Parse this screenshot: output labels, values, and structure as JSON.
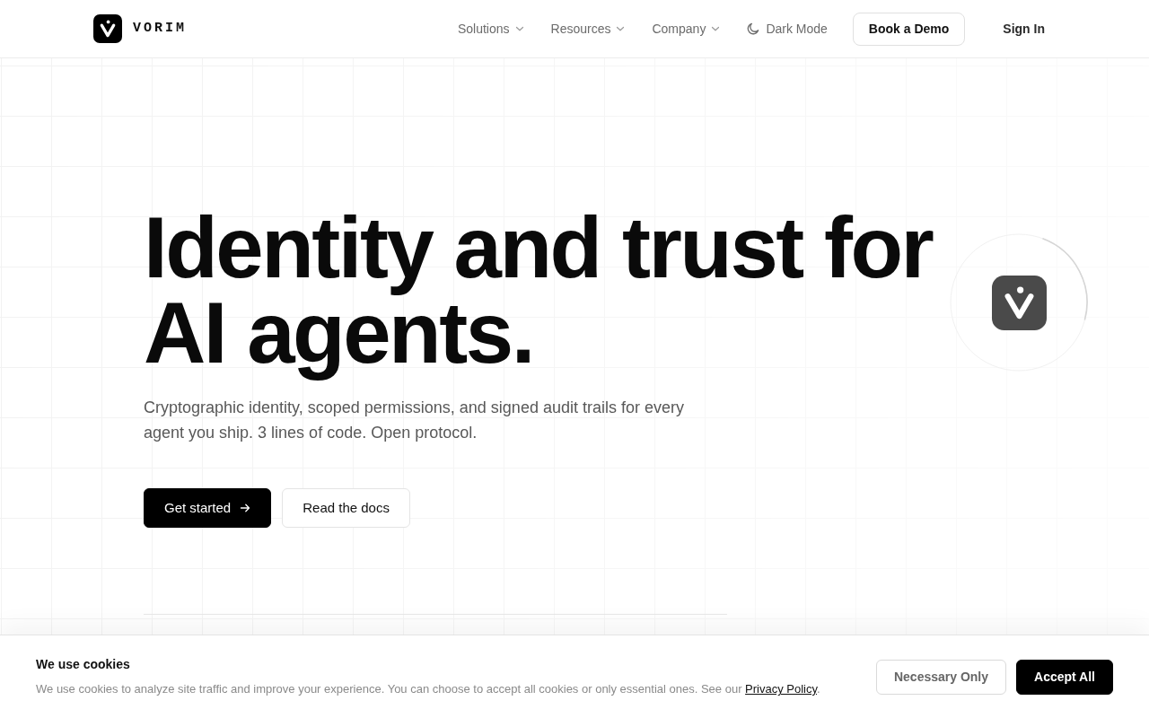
{
  "navbar": {
    "brand": "VORIM",
    "menu": [
      {
        "label": "Solutions",
        "kind": "dropdown"
      },
      {
        "label": "Resources",
        "kind": "dropdown"
      },
      {
        "label": "Company",
        "kind": "dropdown"
      },
      {
        "label": "Dark Mode",
        "kind": "theme-toggle"
      }
    ],
    "buttons": [
      {
        "label": "Book a Demo",
        "kind": "outline"
      },
      {
        "label": "Sign In",
        "kind": "plain"
      }
    ]
  },
  "hero": {
    "headline": "Identity and trust for AI agents.",
    "subtitle": "Cryptographic identity, scoped permissions, and signed audit trails for every agent you ship. 3 lines of code. Open protocol.",
    "buttons": [
      {
        "label": "Get started",
        "kind": "primary"
      },
      {
        "label": "Read the docs",
        "kind": "outline"
      }
    ]
  },
  "cookie_banner": {
    "title": "We use cookies",
    "text": "We use cookies to analyze site traffic and improve your experience. You can choose to accept all cookies or only essential ones. See our ",
    "link": "Privacy Policy",
    "text_end": ".",
    "buttons": [
      {
        "label": "Necessary Only",
        "kind": "outline"
      },
      {
        "label": "Accept All",
        "kind": "primary"
      }
    ]
  }
}
